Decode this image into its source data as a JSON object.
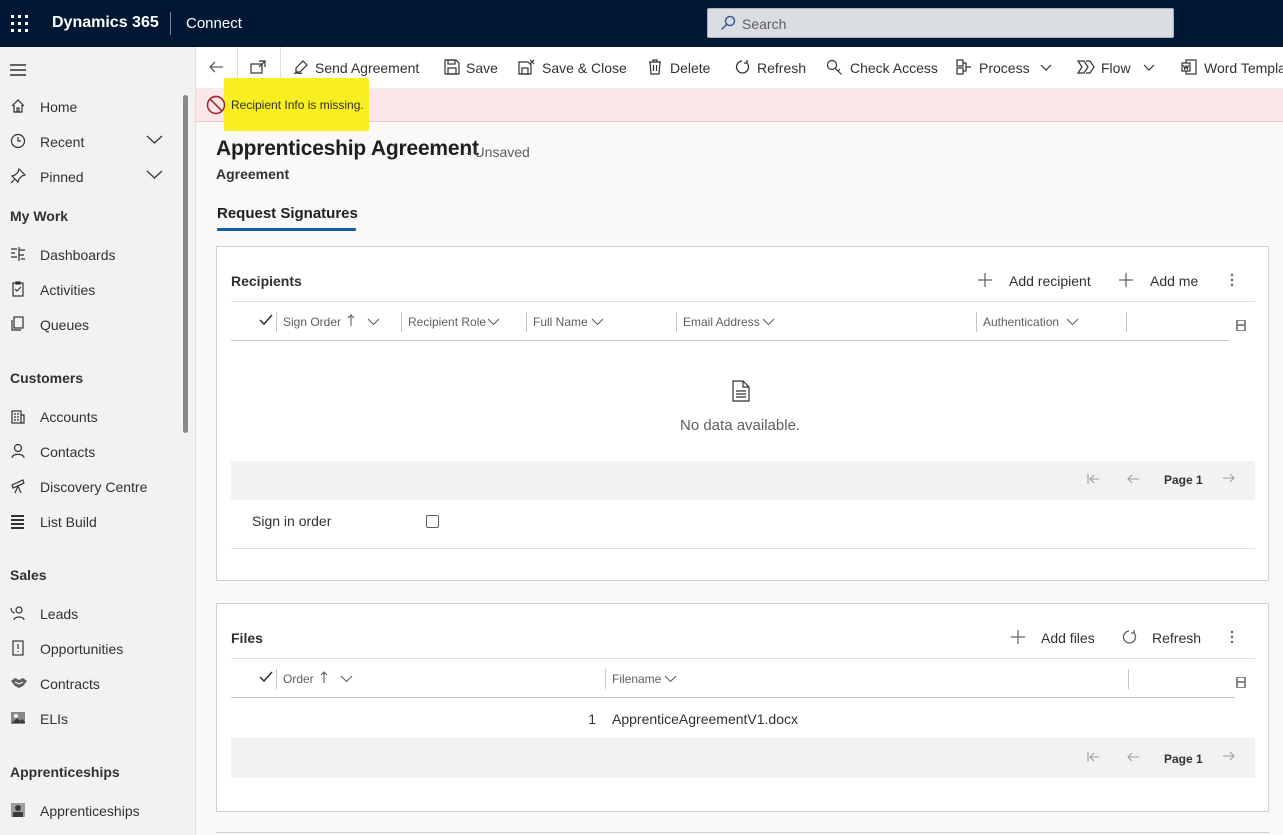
{
  "topbar": {
    "app_name": "Dynamics 365",
    "area_name": "Connect",
    "search_placeholder": "Search"
  },
  "sidenav": {
    "items": [
      {
        "label": "Home",
        "icon": "home-icon"
      },
      {
        "label": "Recent",
        "icon": "clock-icon"
      },
      {
        "label": "Pinned",
        "icon": "pin-icon"
      }
    ],
    "sections": [
      {
        "title": "My Work",
        "items": [
          {
            "label": "Dashboards",
            "icon": "dashboard-icon"
          },
          {
            "label": "Activities",
            "icon": "clipboard-icon"
          },
          {
            "label": "Queues",
            "icon": "queue-icon"
          }
        ]
      },
      {
        "title": "Customers",
        "items": [
          {
            "label": "Accounts",
            "icon": "building-icon"
          },
          {
            "label": "Contacts",
            "icon": "person-icon"
          },
          {
            "label": "Discovery Centre",
            "icon": "telescope-icon"
          },
          {
            "label": "List Build",
            "icon": "list-icon"
          }
        ]
      },
      {
        "title": "Sales",
        "items": [
          {
            "label": "Leads",
            "icon": "phone-person-icon"
          },
          {
            "label": "Opportunities",
            "icon": "opportunity-icon"
          },
          {
            "label": "Contracts",
            "icon": "handshake-icon"
          },
          {
            "label": "ELIs",
            "icon": "image-icon"
          }
        ]
      },
      {
        "title": "Apprenticeships",
        "items": [
          {
            "label": "Apprenticeships",
            "icon": "apprentice-icon"
          }
        ]
      }
    ]
  },
  "commandbar": {
    "send_agreement": "Send Agreement",
    "save": "Save",
    "save_close": "Save & Close",
    "delete": "Delete",
    "refresh": "Refresh",
    "check_access": "Check Access",
    "process": "Process",
    "flow": "Flow",
    "word_templates": "Word Templa"
  },
  "notification": {
    "text": "Recipient Info is missing.",
    "highlight_color": "#f9ee1f"
  },
  "form": {
    "title": "Apprenticeship Agreement",
    "status": "- Unsaved",
    "entity": "Agreement",
    "tab": "Request Signatures"
  },
  "recipients": {
    "title": "Recipients",
    "add_recipient": "Add recipient",
    "add_me": "Add me",
    "columns": [
      "Sign Order",
      "Recipient Role",
      "Full Name",
      "Email Address",
      "Authentication"
    ],
    "empty_text": "No data available.",
    "page_label": "Page 1",
    "sign_in_order_label": "Sign in order"
  },
  "files": {
    "title": "Files",
    "add_files": "Add files",
    "refresh": "Refresh",
    "columns": [
      "Order",
      "Filename"
    ],
    "rows": [
      {
        "order": "1",
        "filename": "ApprenticeAgreementV1.docx"
      }
    ],
    "page_label": "Page 1"
  },
  "colors": {
    "topbar_bg": "#001833",
    "accent": "#115ea3",
    "error_bg": "#fde7e9",
    "error_icon": "#a4262c"
  }
}
